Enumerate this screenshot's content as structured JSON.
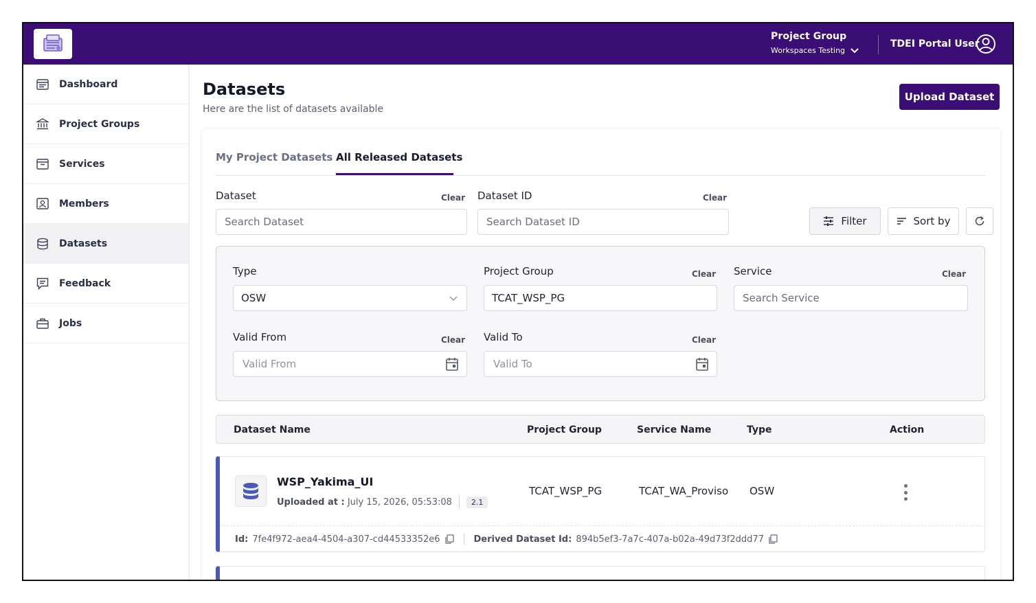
{
  "header": {
    "project_group_label": "Project Group",
    "project_group_value": "Workspaces Testing",
    "user_name": "TDEI Portal User",
    "brand_color": "#3a0e74"
  },
  "sidebar": {
    "items": [
      {
        "label": "Dashboard",
        "icon": "dashboard-icon"
      },
      {
        "label": "Project Groups",
        "icon": "bank-icon"
      },
      {
        "label": "Services",
        "icon": "archive-box-icon"
      },
      {
        "label": "Members",
        "icon": "members-icon"
      },
      {
        "label": "Datasets",
        "icon": "database-icon",
        "active": true
      },
      {
        "label": "Feedback",
        "icon": "feedback-icon"
      },
      {
        "label": "Jobs",
        "icon": "briefcase-icon"
      }
    ]
  },
  "page": {
    "title": "Datasets",
    "subtitle": "Here are the list of datasets available",
    "upload_label": "Upload Dataset"
  },
  "tabs": {
    "my": "My Project Datasets",
    "all": "All Released Datasets",
    "active": "all"
  },
  "search": {
    "dataset_label": "Dataset",
    "dataset_placeholder": "Search Dataset",
    "dataset_id_label": "Dataset ID",
    "dataset_id_placeholder": "Search Dataset ID",
    "clear": "Clear",
    "filter_label": "Filter",
    "sort_label": "Sort by"
  },
  "filters": {
    "type_label": "Type",
    "type_value": "OSW",
    "project_group_label": "Project Group",
    "project_group_value": "TCAT_WSP_PG",
    "service_label": "Service",
    "service_placeholder": "Search Service",
    "valid_from_label": "Valid From",
    "valid_from_placeholder": "Valid From",
    "valid_to_label": "Valid To",
    "valid_to_placeholder": "Valid To",
    "clear": "Clear"
  },
  "table": {
    "headers": {
      "name": "Dataset Name",
      "project_group": "Project Group",
      "service": "Service Name",
      "type": "Type",
      "action": "Action"
    },
    "rows": [
      {
        "name": "WSP_Yakima_UI",
        "uploaded_label": "Uploaded at :",
        "uploaded_value": "July 15, 2026, 05:53:08",
        "version": "2.1",
        "project_group": "TCAT_WSP_PG",
        "service": "TCAT_WA_Proviso",
        "type": "OSW",
        "id_label": "Id:",
        "id_value": "7fe4f972-aea4-4504-a307-cd44533352e6",
        "derived_label": "Derived Dataset Id:",
        "derived_value": "894b5ef3-7a7c-407a-b02a-49d73f2ddd77"
      }
    ]
  }
}
